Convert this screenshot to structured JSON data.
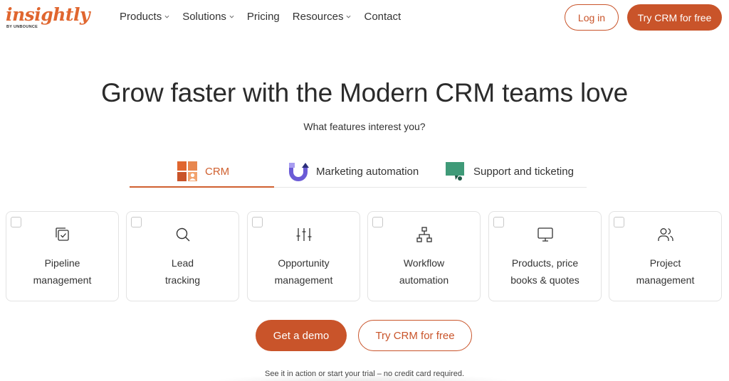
{
  "logo": {
    "word": "insightly",
    "sub": "BY UNBOUNCE"
  },
  "nav": {
    "items": [
      {
        "label": "Products",
        "dropdown": true
      },
      {
        "label": "Solutions",
        "dropdown": true
      },
      {
        "label": "Pricing",
        "dropdown": false
      },
      {
        "label": "Resources",
        "dropdown": true
      },
      {
        "label": "Contact",
        "dropdown": false
      }
    ],
    "login_label": "Log in",
    "try_label": "Try CRM for free"
  },
  "hero": {
    "title": "Grow faster with the Modern CRM teams love",
    "subtitle": "What features interest you?"
  },
  "tabs": [
    {
      "label": "CRM",
      "icon": "crm-grid-icon",
      "active": true
    },
    {
      "label": "Marketing automation",
      "icon": "magnet-icon",
      "active": false
    },
    {
      "label": "Support and ticketing",
      "icon": "chat-ticket-icon",
      "active": false
    }
  ],
  "features": [
    {
      "line1": "Pipeline",
      "line2": "management",
      "icon": "pipeline-check-icon",
      "checked": false
    },
    {
      "line1": "Lead",
      "line2": "tracking",
      "icon": "search-icon",
      "checked": false
    },
    {
      "line1": "Opportunity",
      "line2": "management",
      "icon": "sliders-icon",
      "checked": false
    },
    {
      "line1": "Workflow",
      "line2": "automation",
      "icon": "workflow-icon",
      "checked": false
    },
    {
      "line1": "Products, price",
      "line2": "books & quotes",
      "icon": "monitor-icon",
      "checked": false
    },
    {
      "line1": "Project",
      "line2": "management",
      "icon": "users-icon",
      "checked": false
    }
  ],
  "cta": {
    "demo_label": "Get a demo",
    "try_label": "Try CRM for free",
    "note": "See it in action or start your trial – no credit card required."
  },
  "colors": {
    "brand": "#c9542a",
    "accent": "#d0602f",
    "teal": "#3f9a78",
    "purple": "#6b5bd6"
  }
}
